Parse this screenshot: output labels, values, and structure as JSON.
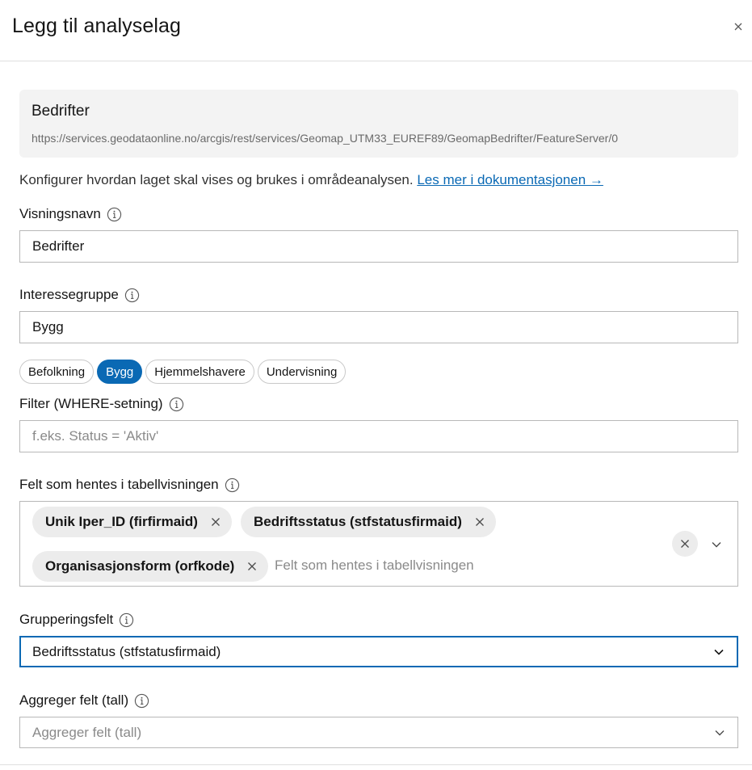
{
  "dialog": {
    "title": "Legg til analyselag",
    "close_icon": "close-icon"
  },
  "source": {
    "name": "Bedrifter",
    "url": "https://services.geodataonline.no/arcgis/rest/services/Geomap_UTM33_EUREF89/GeomapBedrifter/FeatureServer/0"
  },
  "intro": {
    "text": "Konfigurer hvordan laget skal vises og brukes i områdeanalysen. ",
    "link": "Les mer i dokumentasjonen →"
  },
  "display_name": {
    "label": "Visningsnavn",
    "value": "Bedrifter"
  },
  "interest_group": {
    "label": "Interessegruppe",
    "value": "Bygg",
    "options": [
      "Befolkning",
      "Bygg",
      "Hjemmelshavere",
      "Undervisning"
    ],
    "selected": "Bygg",
    "accent_color": "#0a69b4"
  },
  "filter": {
    "label": "Filter (WHERE-setning)",
    "placeholder": "f.eks. Status = 'Aktiv'"
  },
  "fields": {
    "label": "Felt som hentes i tabellvisningen",
    "tags": [
      "Unik Iper_ID (firfirmaid)",
      "Bedriftsstatus (stfstatusfirmaid)",
      "Organisasjonsform (orfkode)"
    ],
    "placeholder": "Felt som hentes i tabellvisningen"
  },
  "grouping": {
    "label": "Grupperingsfelt",
    "value": "Bedriftsstatus (stfstatusfirmaid)"
  },
  "aggregate": {
    "label": "Aggreger felt (tall)",
    "placeholder": "Aggreger felt (tall)"
  }
}
